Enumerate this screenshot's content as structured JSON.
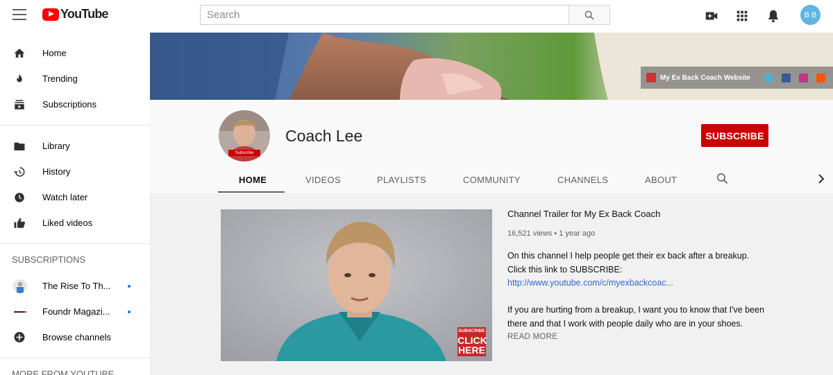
{
  "brand": {
    "name": "YouTube"
  },
  "search": {
    "placeholder": "Search"
  },
  "user": {
    "initials": "B B"
  },
  "sidebar": {
    "main": [
      {
        "label": "Home",
        "icon": "home-icon"
      },
      {
        "label": "Trending",
        "icon": "trending-icon"
      },
      {
        "label": "Subscriptions",
        "icon": "subscriptions-icon"
      }
    ],
    "library": [
      {
        "label": "Library",
        "icon": "library-icon"
      },
      {
        "label": "History",
        "icon": "history-icon"
      },
      {
        "label": "Watch later",
        "icon": "watch-later-icon"
      },
      {
        "label": "Liked videos",
        "icon": "liked-videos-icon"
      }
    ],
    "subscriptions_heading": "SUBSCRIPTIONS",
    "subscriptions": [
      {
        "label": "The Rise To Th..."
      },
      {
        "label": "Foundr Magazi..."
      }
    ],
    "browse_channels": "Browse channels",
    "more_heading": "MORE FROM YOUTUBE"
  },
  "banner": {
    "link_label": "My Ex Back Coach Website"
  },
  "channel": {
    "name": "Coach Lee",
    "subscribe_label": "SUBSCRIBE",
    "avatar_badge": "Subscribe",
    "tabs": [
      "HOME",
      "VIDEOS",
      "PLAYLISTS",
      "COMMUNITY",
      "CHANNELS",
      "ABOUT"
    ]
  },
  "featured": {
    "title": "Channel Trailer for My Ex Back Coach",
    "views": "16,521 views",
    "age": "1 year ago",
    "desc1": "On this channel I help people get their ex back after a breakup. Click this link to SUBSCRIBE:",
    "link": "http://www.youtube.com/c/myexbackcoac...",
    "desc2": "If you are hurting from a breakup, I want you to know that I've been there and that I work with people daily who are in your shoes.",
    "read_more": "READ MORE",
    "overlay": {
      "line1": "SUBSCRIBE",
      "line2": "CLICK",
      "line3": "HERE"
    }
  },
  "colors": {
    "brand_red": "#ff0000",
    "subscribe_red": "#cc0000",
    "link_blue": "#3366cc",
    "dot_blue": "#1a73e8"
  }
}
